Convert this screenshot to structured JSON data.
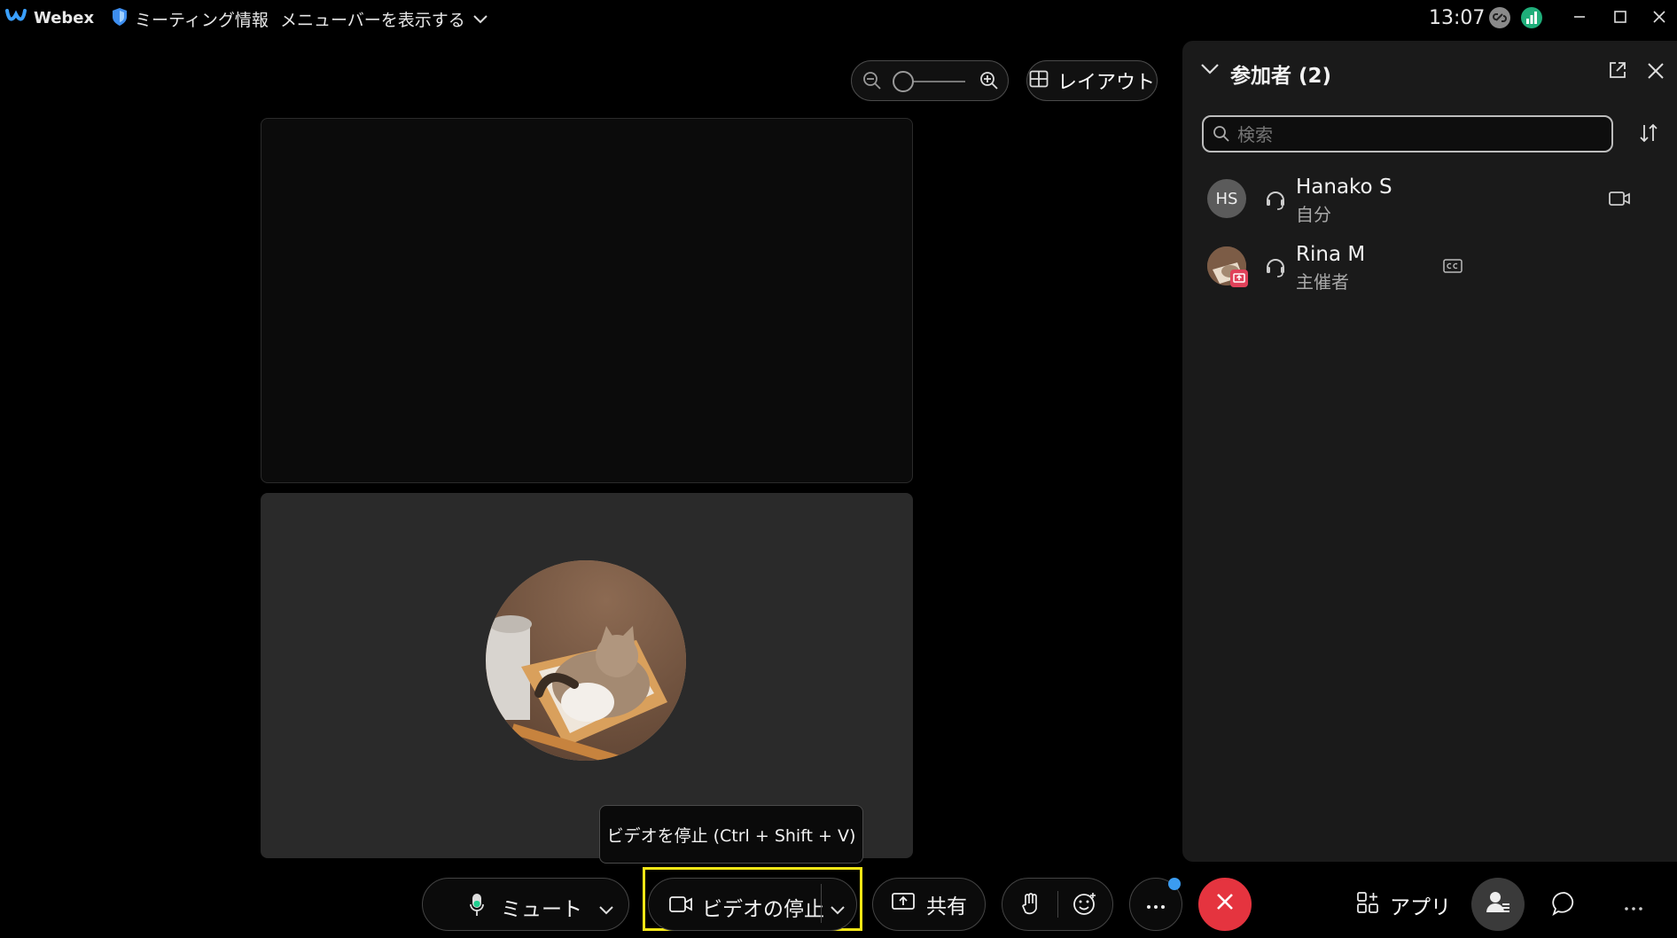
{
  "titlebar": {
    "app_name": "Webex",
    "meeting_info": "ミーティング情報",
    "show_menubar": "メニューバーを表示する",
    "time": "13:07"
  },
  "view_controls": {
    "layout_label": "レイアウト"
  },
  "participants_panel": {
    "title": "参加者 (2)",
    "search_placeholder": "検索",
    "participants": [
      {
        "initials": "HS",
        "name": "Hanako S",
        "role": "自分"
      },
      {
        "name": "Rina M",
        "role": "主催者"
      }
    ]
  },
  "tooltip": {
    "text": "ビデオを停止 (Ctrl + Shift + V)"
  },
  "controls": {
    "mute_label": "ミュート",
    "stop_video_label": "ビデオの停止",
    "share_label": "共有",
    "apps_label": "アプリ"
  },
  "colors": {
    "end_call": "#e5343f",
    "highlight": "#f5e616",
    "notification_dot": "#3b9cf0",
    "panel_bg": "#1a1a1a",
    "tile_bottom": "#2a2a2a"
  },
  "icons": {
    "app_logo": "webex-logo-icon",
    "meeting_info": "shield-icon",
    "mute": "microphone-icon",
    "video": "camera-icon",
    "share": "share-screen-icon",
    "raise_hand": "hand-icon",
    "reactions": "smiley-icon",
    "more": "ellipsis-icon",
    "end": "close-icon",
    "apps": "apps-grid-icon",
    "participants": "participants-icon",
    "chat": "chat-bubble-icon"
  }
}
